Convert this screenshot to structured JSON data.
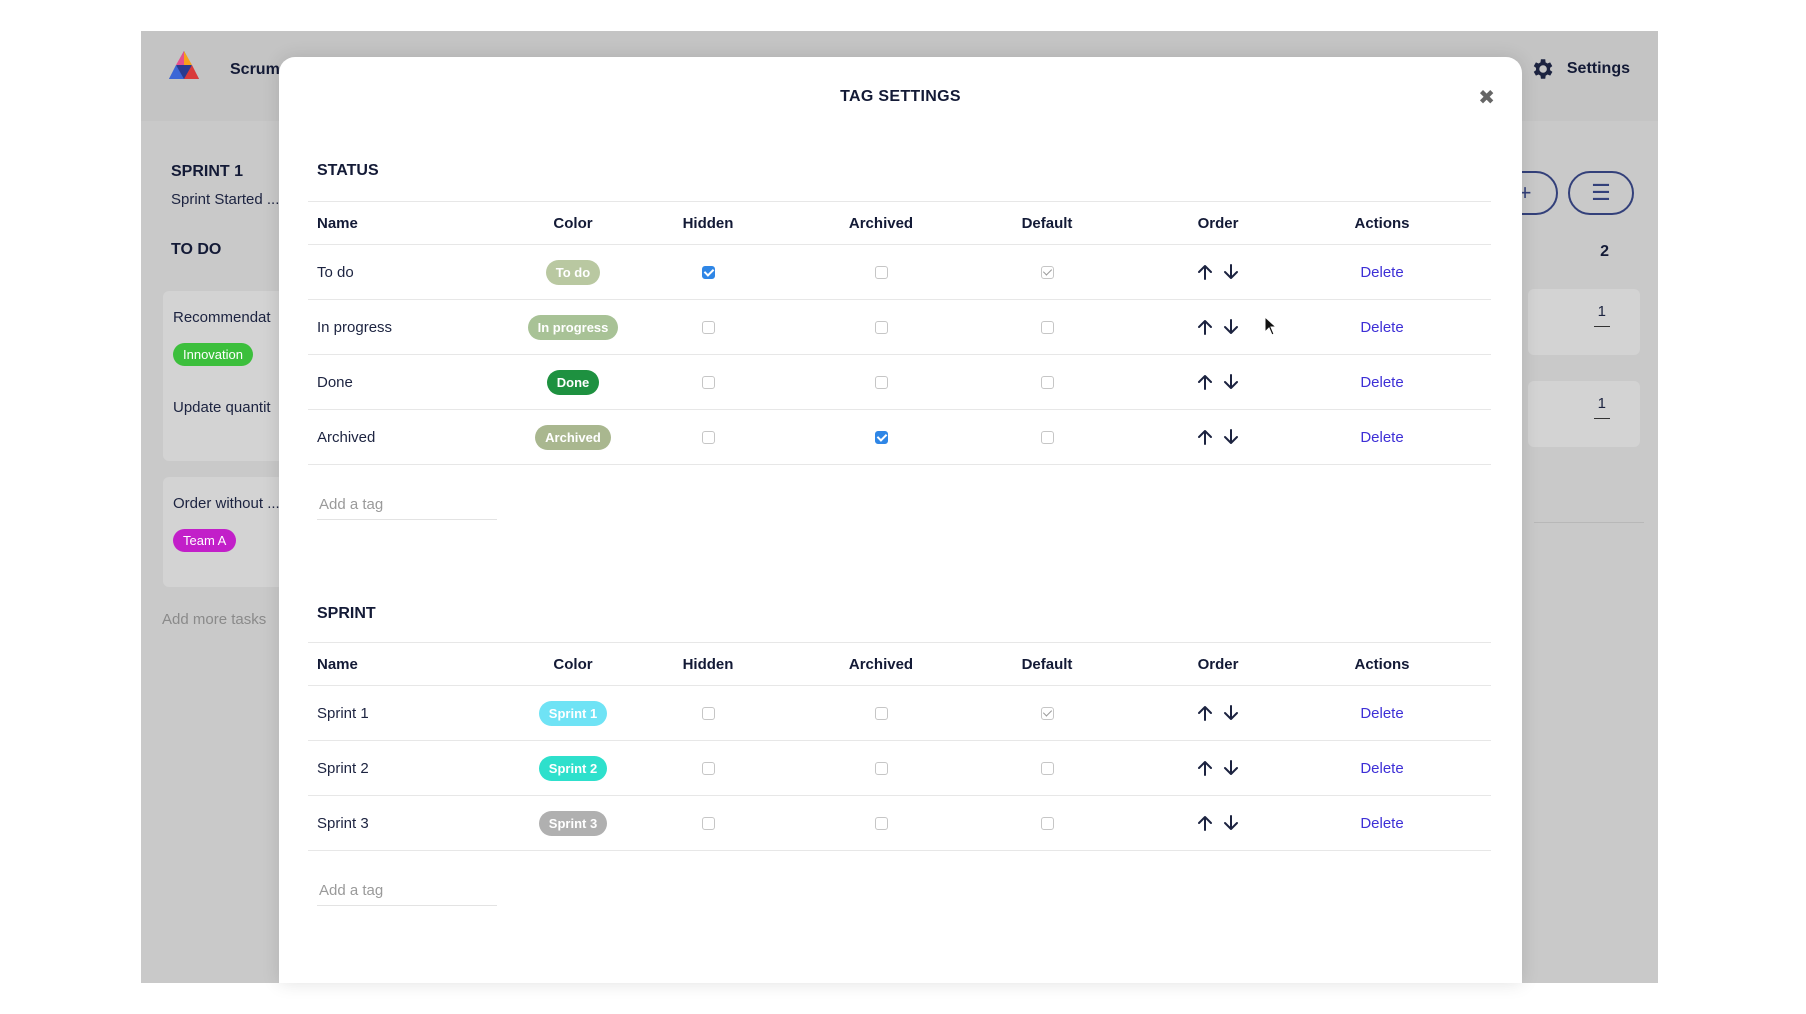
{
  "app": {
    "title": "Scrum",
    "settings_label": "Settings",
    "sprint_title": "SPRINT 1",
    "sprint_subtitle": "Sprint Started ...",
    "column_title": "TO DO",
    "column_count": "2",
    "cards": [
      {
        "text": "Recommendat",
        "tag": "Innovation",
        "tag_color": "#3cbf3c"
      },
      {
        "text": "Update quantit",
        "tag": "",
        "tag_color": ""
      },
      {
        "text": "Order without ...",
        "tag": "Team A",
        "tag_color": "#c21fc9"
      }
    ],
    "card_counts": [
      "1",
      "1"
    ],
    "add_more": "Add more tasks"
  },
  "modal": {
    "title": "TAG SETTINGS",
    "close_icon": "close-icon",
    "columns": [
      "Name",
      "Color",
      "Hidden",
      "Archived",
      "Default",
      "Order",
      "Actions"
    ],
    "status": {
      "title": "STATUS",
      "rows": [
        {
          "name": "To do",
          "badge": "To do",
          "badge_color": "#b9c8a1",
          "hidden": true,
          "archived": false,
          "default": true,
          "action": "Delete"
        },
        {
          "name": "In progress",
          "badge": "In progress",
          "badge_color": "#a8c296",
          "hidden": false,
          "archived": false,
          "default": false,
          "action": "Delete"
        },
        {
          "name": "Done",
          "badge": "Done",
          "badge_color": "#1e9140",
          "hidden": false,
          "archived": false,
          "default": false,
          "action": "Delete"
        },
        {
          "name": "Archived",
          "badge": "Archived",
          "badge_color": "#a9b78f",
          "hidden": false,
          "archived": true,
          "default": false,
          "action": "Delete"
        }
      ],
      "add_placeholder": "Add a tag"
    },
    "sprint": {
      "title": "SPRINT",
      "rows": [
        {
          "name": "Sprint 1",
          "badge": "Sprint 1",
          "badge_color": "#6fe3f5",
          "hidden": false,
          "archived": false,
          "default": true,
          "action": "Delete"
        },
        {
          "name": "Sprint 2",
          "badge": "Sprint 2",
          "badge_color": "#2ee0cc",
          "hidden": false,
          "archived": false,
          "default": false,
          "action": "Delete"
        },
        {
          "name": "Sprint 3",
          "badge": "Sprint 3",
          "badge_color": "#b0b0b0",
          "hidden": false,
          "archived": false,
          "default": false,
          "action": "Delete"
        }
      ],
      "add_placeholder": "Add a tag"
    }
  }
}
